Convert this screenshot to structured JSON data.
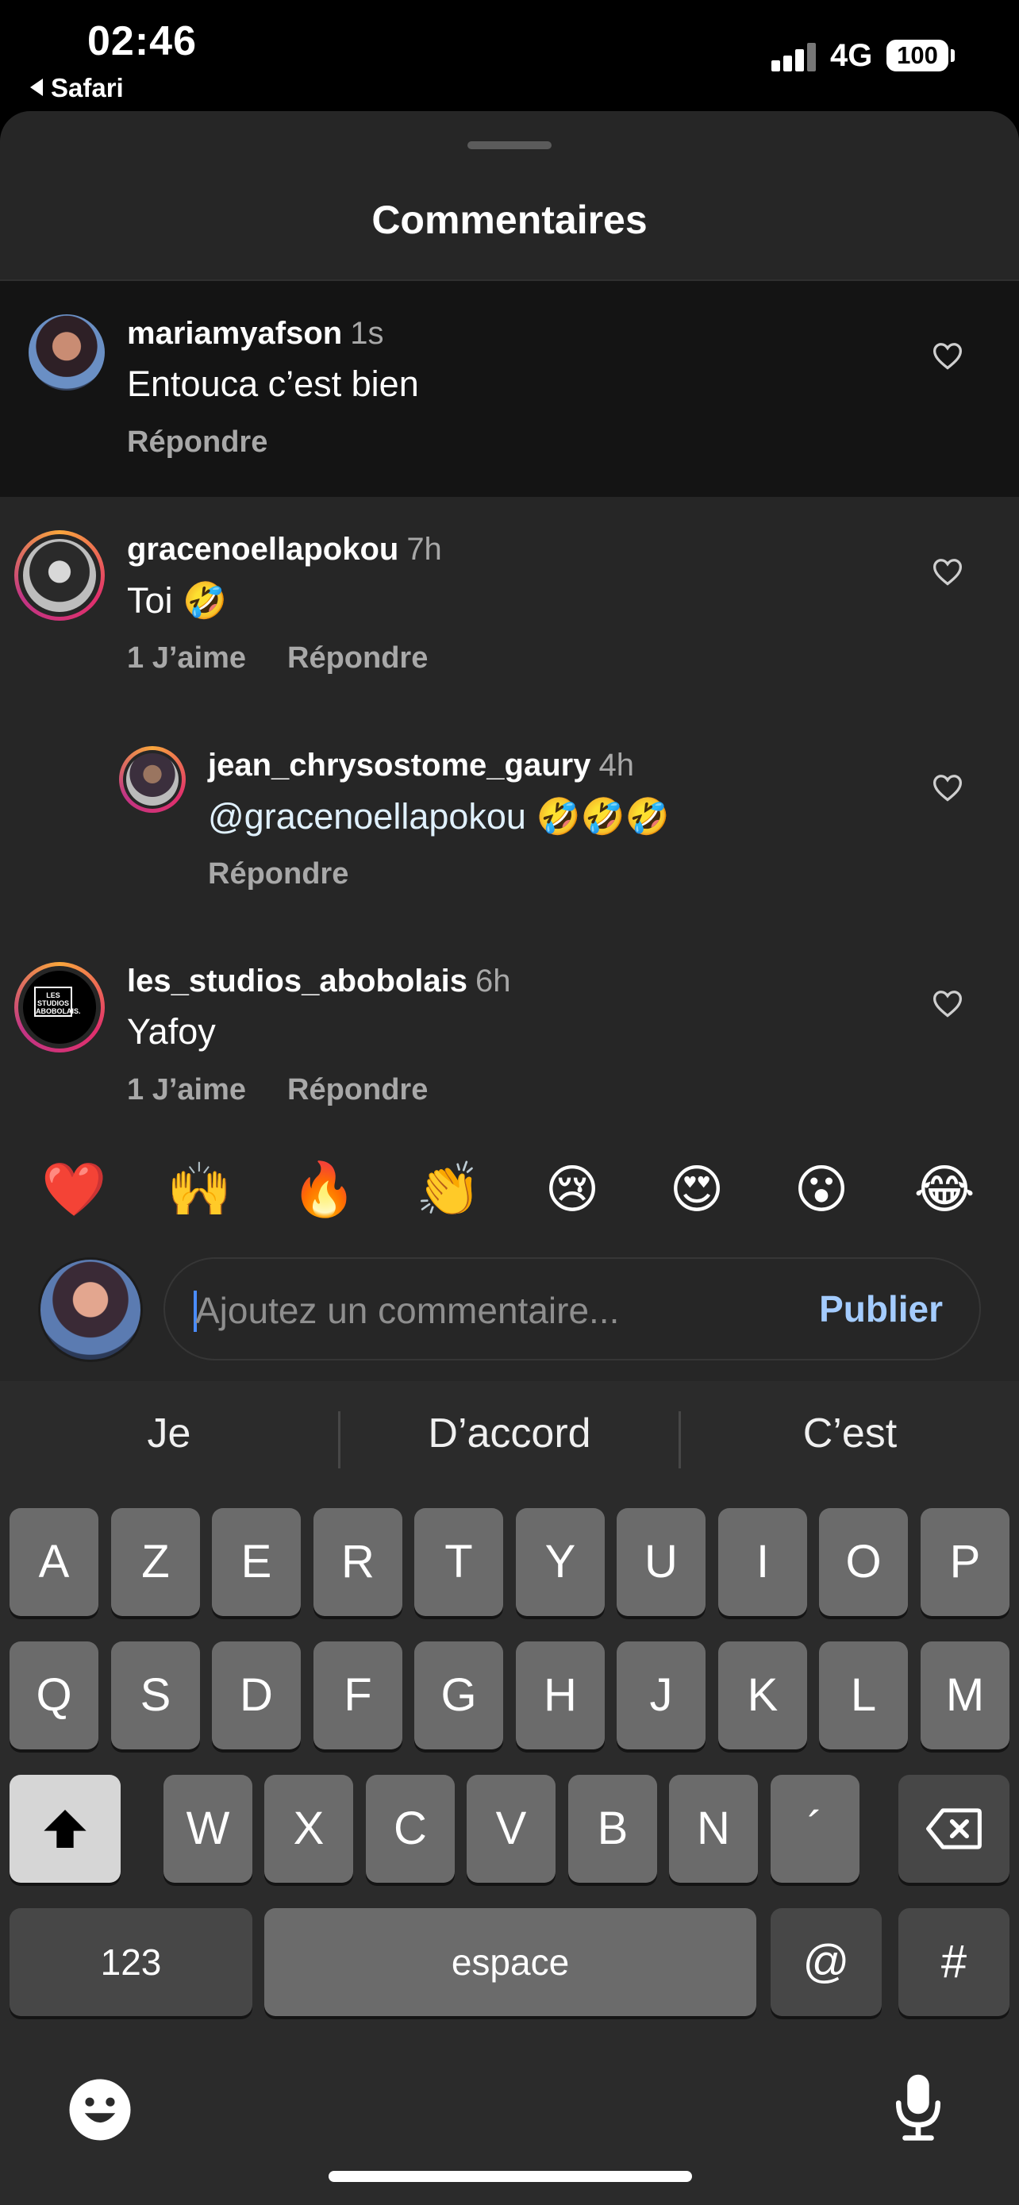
{
  "status_bar": {
    "time": "02:46",
    "back_app": "Safari",
    "network": "4G",
    "battery": "100"
  },
  "sheet": {
    "title": "Commentaires"
  },
  "comments": [
    {
      "username": "mariamyafson",
      "time": "1s",
      "text": "Entouca c’est bien",
      "likes": "",
      "reply": "Répondre",
      "highlighted": true
    },
    {
      "username": "gracenoellapokou",
      "time": "7h",
      "text": "Toi 🤣",
      "likes": "1 J’aime",
      "reply": "Répondre"
    },
    {
      "username": "jean_chrysostome_gaury",
      "time": "4h",
      "mention": "@gracenoellapokou",
      "text": " 🤣🤣🤣",
      "reply": "Répondre"
    },
    {
      "username": "les_studios_abobolais",
      "time": "6h",
      "text": "Yafoy",
      "likes": "1 J’aime",
      "reply": "Répondre",
      "avatar_text": "LES STUDIOS ABOBOLAIS."
    }
  ],
  "emoji_bar": [
    "❤️",
    "🙌",
    "🔥",
    "👏",
    "😢",
    "😍",
    "😮",
    "😂"
  ],
  "composer": {
    "placeholder": "Ajoutez un commentaire...",
    "value": "",
    "publish_label": "Publier"
  },
  "keyboard": {
    "suggestions": [
      "Je",
      "D’accord",
      "C’est"
    ],
    "row1": [
      "A",
      "Z",
      "E",
      "R",
      "T",
      "Y",
      "U",
      "I",
      "O",
      "P"
    ],
    "row2": [
      "Q",
      "S",
      "D",
      "F",
      "G",
      "H",
      "J",
      "K",
      "L",
      "M"
    ],
    "row3": [
      "W",
      "X",
      "C",
      "V",
      "B",
      "N",
      "´"
    ],
    "numbers_label": "123",
    "space_label": "espace",
    "at_label": "@",
    "hash_label": "#"
  },
  "colors": {
    "sheet_bg": "#262626",
    "publish": "#a4ccff",
    "secondary_text": "#a8a8a8"
  }
}
